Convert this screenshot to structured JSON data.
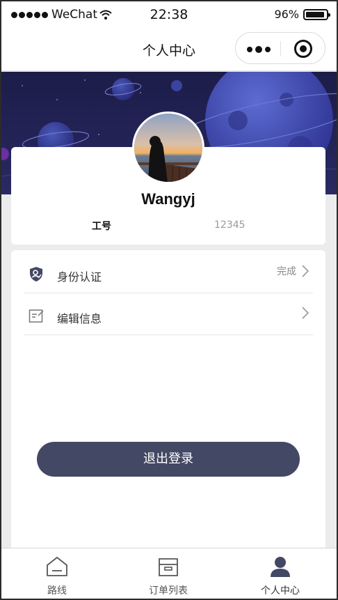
{
  "status_bar": {
    "carrier": "WeChat",
    "time": "22:38",
    "battery": "96%"
  },
  "nav": {
    "title": "个人中心"
  },
  "profile": {
    "username": "Wangyj",
    "id_label": "工号",
    "id_value": "12345"
  },
  "menu": {
    "items": [
      {
        "label": "身份认证",
        "status": "完成",
        "icon": "id-shield-icon"
      },
      {
        "label": "编辑信息",
        "status": "",
        "icon": "edit-note-icon"
      }
    ]
  },
  "logout_label": "退出登录",
  "tabbar": {
    "tabs": [
      {
        "label": "路线",
        "icon": "home-route-icon"
      },
      {
        "label": "订单列表",
        "icon": "box-icon"
      },
      {
        "label": "个人中心",
        "icon": "user-icon"
      }
    ],
    "active_index": 2
  },
  "colors": {
    "accent": "#434864",
    "banner": "#222255",
    "page_bg": "#ececec"
  }
}
